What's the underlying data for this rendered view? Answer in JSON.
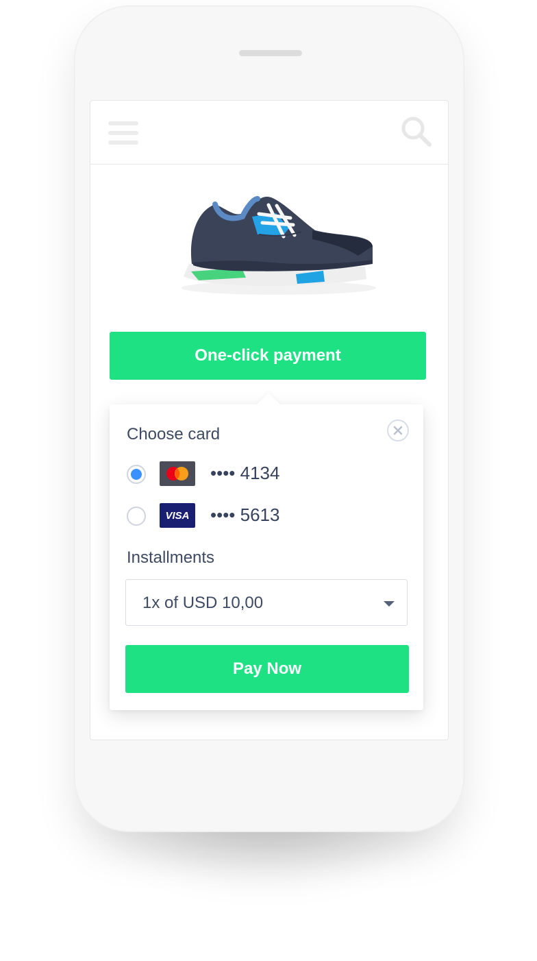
{
  "topbar": {
    "menu_icon": "menu-icon",
    "search_icon": "search-icon"
  },
  "product": {
    "image_icon": "sneaker-illustration"
  },
  "cta": {
    "label": "One-click payment"
  },
  "payment_popup": {
    "close_icon": "close-icon",
    "choose_card_label": "Choose card",
    "cards": [
      {
        "brand": "mastercard",
        "masked_number": "•••• 4134",
        "selected": true
      },
      {
        "brand": "visa",
        "masked_number": "•••• 5613",
        "selected": false,
        "brand_text": "VISA"
      }
    ],
    "installments_label": "Installments",
    "installments_value": "1x of USD 10,00",
    "pay_button_label": "Pay Now"
  },
  "colors": {
    "primary_green": "#1ee184",
    "selected_radio": "#3a90ff",
    "text_dark": "#3e4a62",
    "visa_blue": "#1a1f71"
  }
}
